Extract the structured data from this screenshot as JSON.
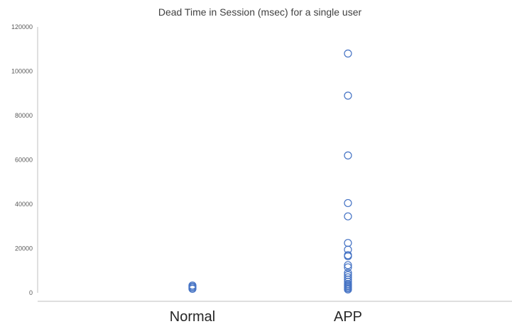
{
  "chart_data": {
    "type": "scatter",
    "title": "Dead Time in Session (msec) for a single user",
    "xlabel": "",
    "ylabel": "",
    "categories": [
      "Normal",
      "APP"
    ],
    "ylim": [
      0,
      120000
    ],
    "yticks": [
      0,
      20000,
      40000,
      60000,
      80000,
      100000,
      120000
    ],
    "ytick_labels": [
      "0",
      "20000",
      "40000",
      "60000",
      "80000",
      "100000",
      "120000"
    ],
    "grid": false,
    "legend": "none",
    "marker": "hollow-circle",
    "series": [
      {
        "values": [
          [
            1,
            1800
          ],
          [
            1,
            2300
          ],
          [
            1,
            2800
          ],
          [
            1,
            3300
          ],
          [
            2,
            108000
          ],
          [
            2,
            89000
          ],
          [
            2,
            62000
          ],
          [
            2,
            40500
          ],
          [
            2,
            34500
          ],
          [
            2,
            22500
          ],
          [
            2,
            19500
          ],
          [
            2,
            17000
          ],
          [
            2,
            16500
          ],
          [
            2,
            12500
          ],
          [
            2,
            11500
          ],
          [
            2,
            9000
          ],
          [
            2,
            8000
          ],
          [
            2,
            7000
          ],
          [
            2,
            6000
          ],
          [
            2,
            5000
          ],
          [
            2,
            4000
          ],
          [
            2,
            3500
          ],
          [
            2,
            3000
          ],
          [
            2,
            2500
          ],
          [
            2,
            2000
          ],
          [
            2,
            1500
          ]
        ]
      }
    ],
    "colors": {
      "marker": "#4472C4",
      "axis": "#BFBFBF",
      "text": "#404040"
    }
  }
}
